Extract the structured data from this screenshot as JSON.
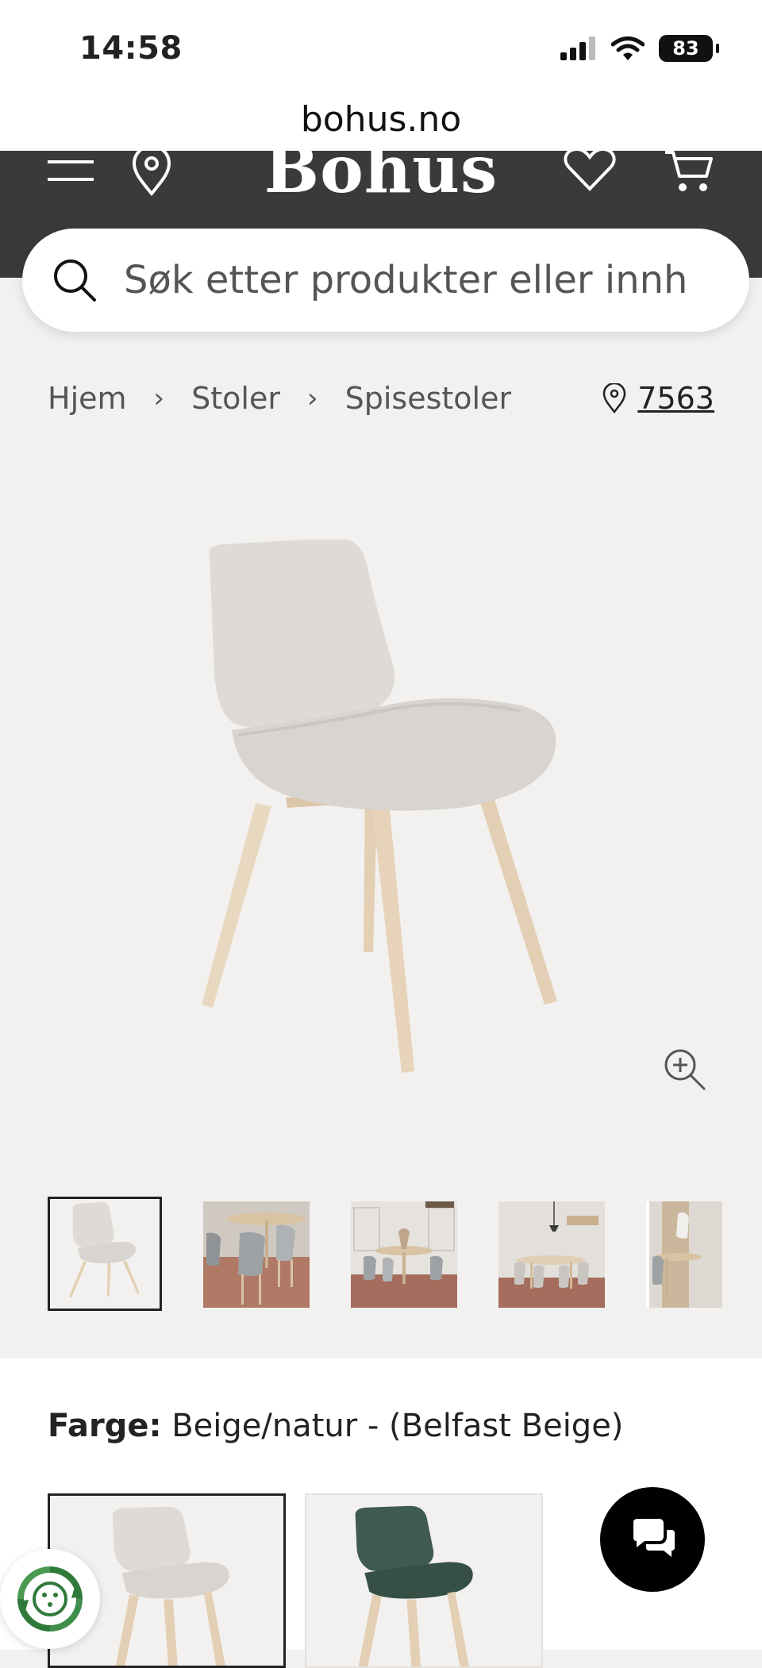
{
  "status_bar": {
    "time": "14:58",
    "battery": "83"
  },
  "browser": {
    "url": "bohus.no"
  },
  "header": {
    "logo": "Bohus"
  },
  "search": {
    "placeholder": "Søk etter produkter eller innh"
  },
  "breadcrumb": {
    "items": [
      "Hjem",
      "Stoler",
      "Spisestoler"
    ]
  },
  "store": {
    "number": "7563"
  },
  "product": {
    "color_label": "Farge:",
    "color_value": "Beige/natur - (Belfast Beige)"
  },
  "icons": {
    "menu": "menu-icon",
    "location": "location-pin-icon",
    "wishlist": "heart-icon",
    "cart": "cart-icon",
    "search": "search-icon",
    "zoom": "zoom-in-icon",
    "chat": "chat-icon",
    "eco": "recycle-icon"
  },
  "colors": {
    "header_bg": "#3a3a3c",
    "page_bg": "#f3f1ef",
    "seat_beige": "#dedad5",
    "seat_green": "#3f5a4e",
    "wood": "#e3cfb4"
  }
}
